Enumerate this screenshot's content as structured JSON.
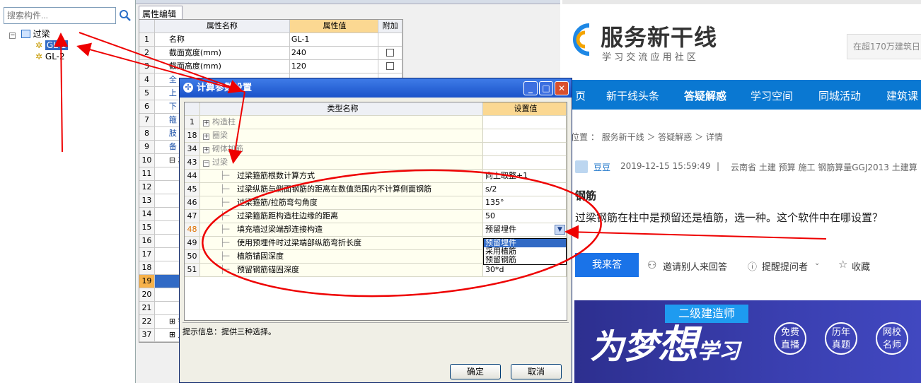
{
  "tree": {
    "search_placeholder": "搜索构件...",
    "root_label": "过梁",
    "items": [
      "GL-1",
      "GL-2"
    ]
  },
  "property_panel": {
    "tab": "属性编辑",
    "headers": {
      "name": "属性名称",
      "value": "属性值",
      "extra": "附加"
    },
    "rows": [
      {
        "num": "1",
        "name": "名称",
        "value": "GL-1",
        "check": false
      },
      {
        "num": "2",
        "name": "截面宽度(mm)",
        "value": "240",
        "check": true
      },
      {
        "num": "3",
        "name": "截面高度(mm)",
        "value": "120",
        "check": true
      },
      {
        "num": "4",
        "name": "全",
        "value": "",
        "check": false
      },
      {
        "num": "5",
        "name": "上",
        "value": "",
        "check": false
      },
      {
        "num": "6",
        "name": "下",
        "value": "",
        "check": false
      },
      {
        "num": "7",
        "name": "箍",
        "value": "",
        "check": false
      },
      {
        "num": "8",
        "name": "肢",
        "value": "",
        "check": false
      },
      {
        "num": "9",
        "name": "备",
        "value": "",
        "check": false
      },
      {
        "num": "10",
        "name": "⊟ 其",
        "value": "",
        "check": false
      },
      {
        "num": "11",
        "name": "",
        "value": "",
        "check": false
      },
      {
        "num": "12",
        "name": "",
        "value": "",
        "check": false
      },
      {
        "num": "13",
        "name": "",
        "value": "",
        "check": false
      },
      {
        "num": "14",
        "name": "",
        "value": "",
        "check": false
      },
      {
        "num": "15",
        "name": "",
        "value": "",
        "check": false
      },
      {
        "num": "16",
        "name": "",
        "value": "",
        "check": false
      },
      {
        "num": "17",
        "name": "",
        "value": "",
        "check": false
      },
      {
        "num": "18",
        "name": "",
        "value": "",
        "check": false
      },
      {
        "num": "19",
        "name": "",
        "value": "",
        "check": false
      },
      {
        "num": "20",
        "name": "",
        "value": "",
        "check": false
      },
      {
        "num": "21",
        "name": "",
        "value": "",
        "check": false
      },
      {
        "num": "22",
        "name": "⊞ 锚",
        "value": "",
        "check": false
      },
      {
        "num": "37",
        "name": "⊞ 显",
        "value": "",
        "check": false
      }
    ]
  },
  "dialog": {
    "title": "计算参数设置",
    "headers": {
      "name": "类型名称",
      "value": "设置值"
    },
    "rows": [
      {
        "num": "1",
        "name": "构造柱",
        "value": "",
        "expand": "+",
        "level": 0
      },
      {
        "num": "18",
        "name": "圈梁",
        "value": "",
        "expand": "+",
        "level": 0
      },
      {
        "num": "34",
        "name": "砌体加筋",
        "value": "",
        "expand": "+",
        "level": 0
      },
      {
        "num": "43",
        "name": "过梁",
        "value": "",
        "expand": "−",
        "level": 0
      },
      {
        "num": "44",
        "name": "过梁箍筋根数计算方式",
        "value": "向上取整+1",
        "level": 1
      },
      {
        "num": "45",
        "name": "过梁纵筋与侧面钢筋的距离在数值范围内不计算侧面钢筋",
        "value": "s/2",
        "level": 1
      },
      {
        "num": "46",
        "name": "过梁箍筋/拉筋弯勾角度",
        "value": "135°",
        "level": 1
      },
      {
        "num": "47",
        "name": "过梁箍筋距构造柱边缘的距离",
        "value": "50",
        "level": 1
      },
      {
        "num": "48",
        "name": "填充墙过梁端部连接构造",
        "value": "预留埋件",
        "level": 1
      },
      {
        "num": "49",
        "name": "使用预埋件时过梁端部纵筋弯折长度",
        "value": "",
        "level": 1
      },
      {
        "num": "50",
        "name": "植筋锚固深度",
        "value": "",
        "level": 1
      },
      {
        "num": "51",
        "name": "预留钢筋锚固深度",
        "value": "30*d",
        "level": 1
      }
    ],
    "dropdown_options": [
      "预留埋件",
      "采用植筋",
      "预留钢筋"
    ],
    "hint": "提示信息：提供三种选择。",
    "ok_label": "确定",
    "cancel_label": "取消"
  },
  "web": {
    "logo_title": "服务新干线",
    "logo_subtitle": "学 习 交 流 应 用 社 区",
    "search_placeholder": "在超170万建筑日",
    "nav": [
      "页",
      "新干线头条",
      "答疑解惑",
      "学习空间",
      "同城活动",
      "建筑课"
    ],
    "breadcrumb": "前位置 ： 服务新干线 ＞ 答疑解惑 ＞ 详情",
    "author": "豆豆",
    "date": "2019-12-15 15:59:49",
    "separator": "|",
    "tags": "云南省  土建 预算 施工 钢筋算量GGJ2013 土建算",
    "question_title": "钢筋",
    "question_body": "过梁钢筋在柱中是预留还是植筋，选一种。这个软件中在哪设置？",
    "answer_btn": "我来答",
    "invite": "邀请别人来回答",
    "remind": "提醒提问者",
    "favorite": "收藏",
    "banner_badge": "二级建造师",
    "banner_text1": "为梦",
    "banner_text2": "想",
    "banner_text3": "学习",
    "circles": [
      [
        "免费",
        "直播"
      ],
      [
        "历年",
        "真题"
      ],
      [
        "网校",
        "名师"
      ]
    ]
  }
}
